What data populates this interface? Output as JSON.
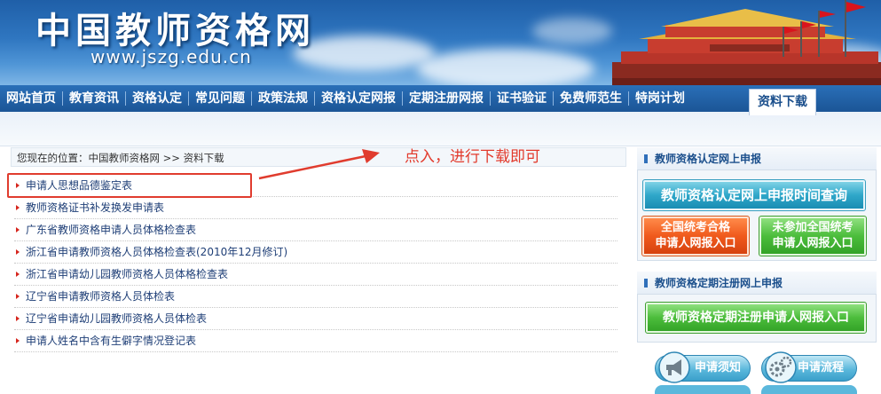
{
  "header": {
    "site_title": "中国教师资格网",
    "site_url": "www.jszg.edu.cn"
  },
  "nav": {
    "items": [
      "网站首页",
      "教育资讯",
      "资格认定",
      "常见问题",
      "政策法规",
      "资格认定网报",
      "定期注册网报",
      "证书验证",
      "免费师范生",
      "特岗计划"
    ],
    "active": "资料下载"
  },
  "breadcrumb": {
    "prefix": "您现在的位置：",
    "home": "中国教师资格网",
    "separator": ">>",
    "current": "资料下载"
  },
  "downloads": [
    "申请人思想品德鉴定表",
    "教师资格证书补发换发申请表",
    "广东省教师资格申请人员体格检查表",
    "浙江省申请教师资格人员体格检查表(2010年12月修订)",
    "浙江省申请幼儿园教师资格人员体格检查表",
    "辽宁省申请教师资格人员体检表",
    "辽宁省申请幼儿园教师资格人员体检表",
    "申请人姓名中含有生僻字情况登记表"
  ],
  "annotation": {
    "text": "点入，进行下载即可",
    "color": "#e23a2c"
  },
  "sidebar": {
    "cert_section_title": "教师资格认定网上申报",
    "cert_time_button": "教师资格认定网上申报时间查询",
    "pass_button_line1": "全国统考合格",
    "pass_button_line2": "申请人网报入口",
    "nopass_button_line1": "未参加全国统考",
    "nopass_button_line2": "申请人网报入口",
    "reg_section_title": "教师资格定期注册网上申报",
    "reg_button": "教师资格定期注册申请人网报入口",
    "notice_button": "申请须知",
    "flow_button": "申请流程"
  },
  "colors": {
    "header_blue": "#2f76c0",
    "nav_blue": "#1b5596",
    "link": "#1f3f77",
    "bullet": "#d6261e"
  }
}
